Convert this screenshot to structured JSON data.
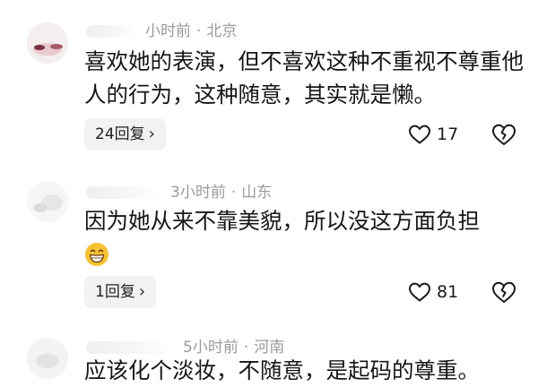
{
  "comments": [
    {
      "meta_time": "小时前",
      "meta_location": "北京",
      "text": "喜欢她的表演，但不喜欢这种不重视不尊重他人的行为，这种随意，其实就是懒。",
      "reply_label": "24回复",
      "like_count": "17"
    },
    {
      "meta_time": "3小时前",
      "meta_location": "山东",
      "text": "因为她从来不靠美貌，所以没这方面负担",
      "emoji": "grinning-face",
      "reply_label": "1回复",
      "like_count": "81"
    },
    {
      "meta_time": "5小时前",
      "meta_location": "河南",
      "text": "应该化个淡妆，不随意，是起码的尊重。"
    }
  ],
  "icons": {
    "chevron": "›",
    "separator": "·"
  },
  "colors": {
    "meta": "#9a9a9a",
    "reply_bg": "#f2f2f2",
    "emoji": "#f7c232"
  }
}
